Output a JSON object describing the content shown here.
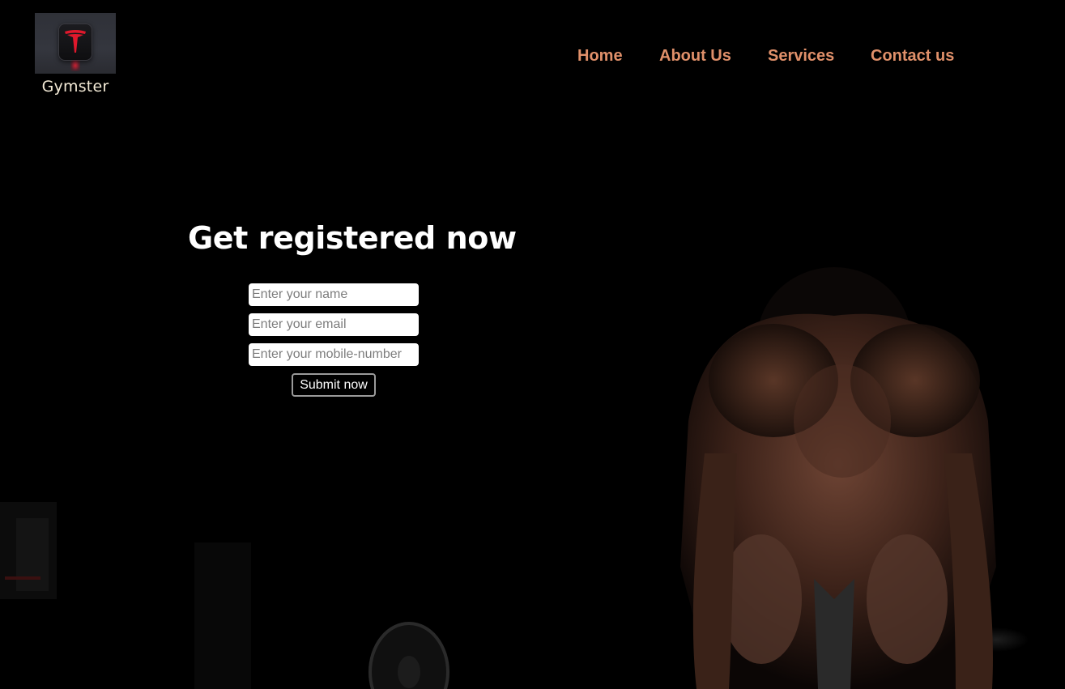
{
  "brand": {
    "name": "Gymster",
    "logo_icon": "car-brand-logo-icon"
  },
  "nav": {
    "items": [
      {
        "label": "Home"
      },
      {
        "label": "About Us"
      },
      {
        "label": "Services"
      },
      {
        "label": "Contact us"
      }
    ]
  },
  "registration": {
    "title": "Get registered now",
    "fields": {
      "name": {
        "placeholder": "Enter your name",
        "value": ""
      },
      "email": {
        "placeholder": "Enter your email",
        "value": ""
      },
      "mobile": {
        "placeholder": "Enter your mobile-number",
        "value": ""
      }
    },
    "submit_label": "Submit now"
  },
  "colors": {
    "background": "#000000",
    "nav_link": "#e0906a",
    "heading": "#ffffff",
    "brand_text": "#f3ead6"
  }
}
